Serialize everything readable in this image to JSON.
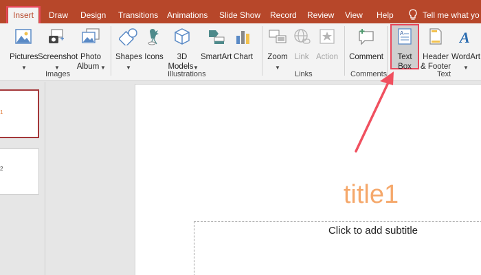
{
  "tabs": [
    "Insert",
    "Draw",
    "Design",
    "Transitions",
    "Animations",
    "Slide Show",
    "Record",
    "Review",
    "View",
    "Help"
  ],
  "tell_me": "Tell me what yo",
  "ribbon": {
    "pictures": "Pictures",
    "screenshot": "Screenshot",
    "photo_album_1": "Photo",
    "photo_album_2": "Album",
    "shapes": "Shapes",
    "icons": "Icons",
    "models_1": "3D",
    "models_2": "Models",
    "smartart": "SmartArt",
    "chart": "Chart",
    "zoom": "Zoom",
    "link": "Link",
    "action": "Action",
    "comment": "Comment",
    "textbox_1": "Text",
    "textbox_2": "Box",
    "header_1": "Header",
    "header_2": "& Footer",
    "wordart": "WordArt"
  },
  "groups": {
    "images": "Images",
    "illustrations": "Illustrations",
    "links": "Links",
    "comments": "Comments",
    "text": "Text"
  },
  "slides": {
    "thumb1_num": "1",
    "thumb2_num": "2"
  },
  "slide": {
    "title": "title1",
    "subtitle": "Click to add subtitle"
  },
  "colors": {
    "accent": "#b7472a",
    "highlight": "#e8485b",
    "title": "#f5a86b"
  }
}
